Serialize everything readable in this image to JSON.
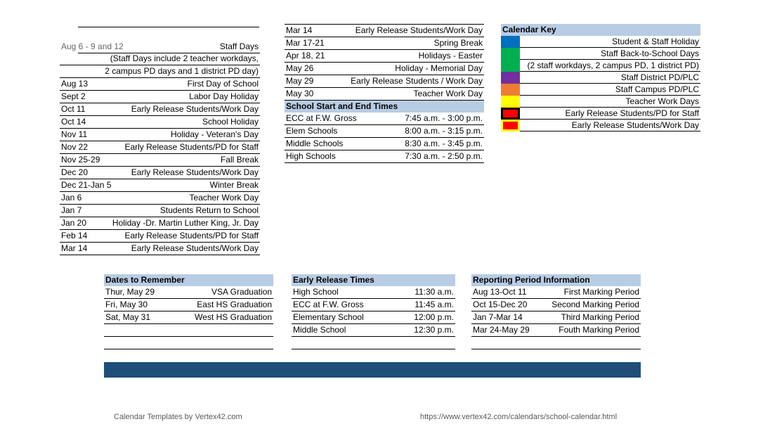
{
  "left_column": {
    "staff_days": {
      "date": "Aug 6 - 9 and 12",
      "label": "Staff Days",
      "note_line1": "(Staff Days include 2 teacher workdays,",
      "note_line2": "2 campus PD days and 1 district PD day)"
    },
    "events": [
      {
        "date": "Aug 13",
        "label": "First Day of School"
      },
      {
        "date": "Sept 2",
        "label": "Labor Day Holiday"
      },
      {
        "date": "Oct 11",
        "label": "Early Release Students/Work Day"
      },
      {
        "date": "Oct 14",
        "label": "School Holiday"
      },
      {
        "date": "Nov 11",
        "label": "Holiday - Veteran's Day"
      },
      {
        "date": "Nov 22",
        "label": "Early Release Students/PD for Staff"
      },
      {
        "date": "Nov 25-29",
        "label": "Fall Break"
      },
      {
        "date": "Dec 20",
        "label": "Early Release Students/Work Day"
      },
      {
        "date": "Dec 21-Jan 5",
        "label": "Winter Break"
      },
      {
        "date": "Jan 6",
        "label": "Teacher Work Day"
      },
      {
        "date": "Jan 7",
        "label": "Students Return to School"
      },
      {
        "date": "Jan 20",
        "label": "Holiday -Dr. Martin Luther King, Jr. Day"
      },
      {
        "date": "Feb 14",
        "label": "Early Release Students/PD for Staff"
      },
      {
        "date": "Mar 14",
        "label": "Early Release Students/Work Day"
      }
    ]
  },
  "middle_column": {
    "events": [
      {
        "date": "Mar 14",
        "label": "Early Release Students/Work Day"
      },
      {
        "date": "Mar 17-21",
        "label": "Spring Break"
      },
      {
        "date": "Apr 18, 21",
        "label": "Holidays - Easter"
      },
      {
        "date": "May 26",
        "label": "Holiday - Memorial Day"
      },
      {
        "date": "May 29",
        "label": "Early Release Students / Work Day"
      },
      {
        "date": "May 30",
        "label": "Teacher Work Day"
      }
    ],
    "school_times": {
      "title": "School Start and End Times",
      "rows": [
        {
          "school": "ECC at F.W. Gross",
          "time": "7:45 a.m. - 3:00 p.m."
        },
        {
          "school": "Elem Schools",
          "time": "8:00 a.m. - 3:15 p.m."
        },
        {
          "school": "Middle Schools",
          "time": "8:30 a.m. - 3:45 p.m."
        },
        {
          "school": "High Schools",
          "time": "7:30 a.m. - 2:50 p.m."
        }
      ]
    }
  },
  "calendar_key": {
    "title": "Calendar Key",
    "items": [
      {
        "label": "Student & Staff Holiday",
        "color": "#0070c0"
      },
      {
        "label": "Staff Back-to-School Days",
        "color": "#00b050"
      },
      {
        "label": "(2 staff workdays, 2 campus PD, 1 district PD)",
        "color": "#00b050"
      },
      {
        "label": "Staff District PD/PLC",
        "color": "#7030a0"
      },
      {
        "label": "Staff Campus PD/PLC",
        "color": "#ed7d31"
      },
      {
        "label": "Teacher Work Days",
        "color": "#ffff00"
      },
      {
        "label": "Early Release Students/PD for Staff",
        "color": "#ff0000",
        "border": "#000000"
      },
      {
        "label": "Early Release Students/Work Day",
        "color": "#ff0000",
        "border": "#ffff00"
      }
    ]
  },
  "dates_to_remember": {
    "title": "Dates to Remember",
    "rows": [
      {
        "date": "Thur, May 29",
        "label": "VSA Graduation"
      },
      {
        "date": "Fri, May 30",
        "label": "East HS Graduation"
      },
      {
        "date": "Sat, May 31",
        "label": "West HS Graduation"
      }
    ]
  },
  "early_release_times": {
    "title": "Early Release Times",
    "rows": [
      {
        "school": "High School",
        "time": "11:30 a.m."
      },
      {
        "school": "ECC at F.W. Gross",
        "time": "11:45 a.m."
      },
      {
        "school": "Elementary School",
        "time": "12:00 p.m."
      },
      {
        "school": "Middle School",
        "time": "12:30 p.m."
      }
    ]
  },
  "reporting_periods": {
    "title": "Reporting Period Information",
    "rows": [
      {
        "dates": "Aug 13-Oct 11",
        "label": "First Marking Period"
      },
      {
        "dates": "Oct 15-Dec 20",
        "label": "Second Marking Period"
      },
      {
        "dates": "Jan 7-Mar 14",
        "label": "Third Marking Period"
      },
      {
        "dates": "Mar 24-May 29",
        "label": "Fouth Marking Period"
      }
    ]
  },
  "footer": {
    "bar_color": "#1f4e79",
    "credit": "Calendar Templates by Vertex42.com",
    "url": "https://www.vertex42.com/calendars/school-calendar.html"
  }
}
